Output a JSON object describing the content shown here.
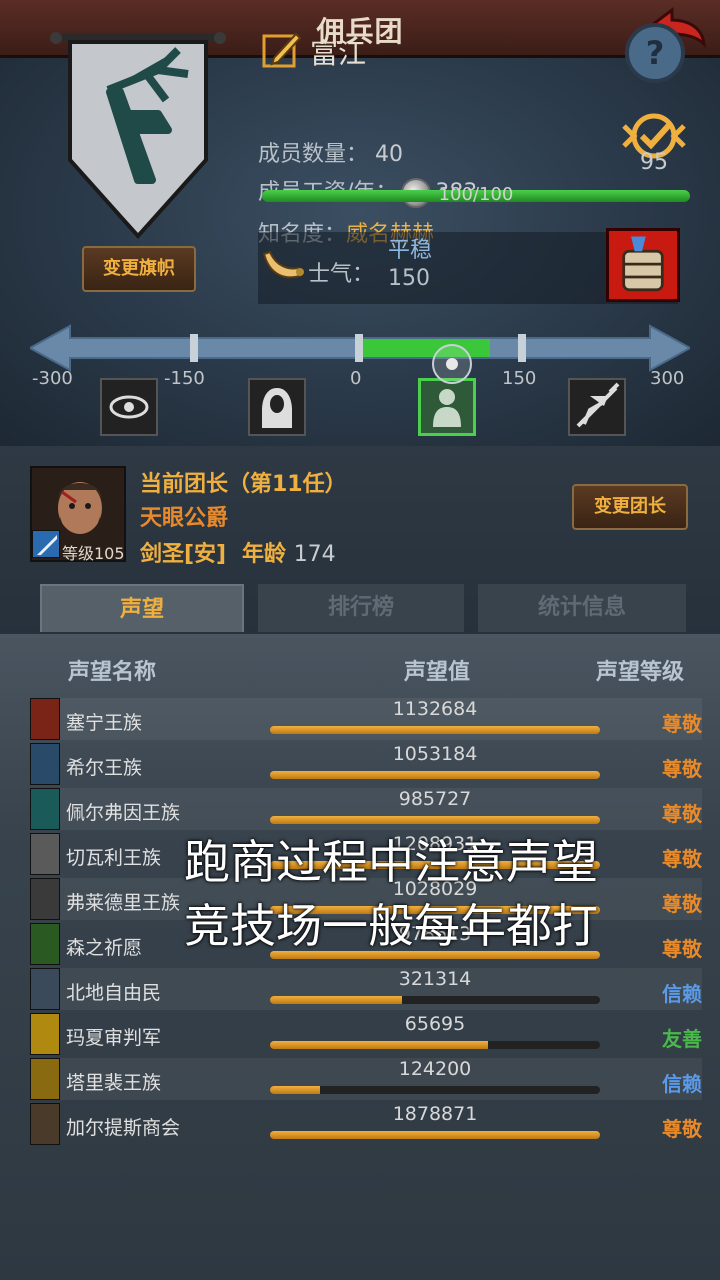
{
  "header": {
    "title": "佣兵团"
  },
  "guild": {
    "name": "富江",
    "members_label": "成员数量：",
    "members_value": "40",
    "salary_label": "成员工资/年：",
    "salary_value": "383",
    "fame_label": "知名度：",
    "fame_value": "威名赫赫",
    "fame_bar_text": "100/100",
    "fame_progress": 1.0,
    "rank_number": "95",
    "change_banner_label": "变更旗帜"
  },
  "morale": {
    "label": "士气：",
    "state": "平稳",
    "value": "150",
    "ticks": [
      "-300",
      "-150",
      "0",
      "150",
      "300"
    ]
  },
  "leader": {
    "role": "当前团长（第11任）",
    "title": "天眼公爵",
    "level_text": "等级105",
    "class": "剑圣[安]",
    "age_label": "年龄",
    "age_value": "174",
    "change_leader_label": "变更团长"
  },
  "tabs": [
    {
      "label": "声望",
      "active": true
    },
    {
      "label": "排行榜",
      "active": false
    },
    {
      "label": "统计信息",
      "active": false
    }
  ],
  "table": {
    "headers": {
      "name": "声望名称",
      "value": "声望值",
      "level": "声望等级"
    },
    "rows": [
      {
        "name": "塞宁王族",
        "value": "1132684",
        "level": "尊敬",
        "progress": 1.0,
        "icon_color": "#7a2418"
      },
      {
        "name": "希尔王族",
        "value": "1053184",
        "level": "尊敬",
        "progress": 1.0,
        "icon_color": "#2a4a6a"
      },
      {
        "name": "佩尔弗因王族",
        "value": "985727",
        "level": "尊敬",
        "progress": 1.0,
        "icon_color": "#1a5a58"
      },
      {
        "name": "切瓦利王族",
        "value": "1208931",
        "level": "尊敬",
        "progress": 1.0,
        "icon_color": "#5a5a5a"
      },
      {
        "name": "弗莱德里王族",
        "value": "1028029",
        "level": "尊敬",
        "progress": 1.0,
        "icon_color": "#3a3a3a"
      },
      {
        "name": "森之祈愿",
        "value": "978613",
        "level": "尊敬",
        "progress": 1.0,
        "icon_color": "#2a5a22"
      },
      {
        "name": "北地自由民",
        "value": "321314",
        "level": "信赖",
        "progress": 0.4,
        "icon_color": "#3a4a5a"
      },
      {
        "name": "玛夏审判军",
        "value": "65695",
        "level": "友善",
        "progress": 0.66,
        "icon_color": "#b08a10"
      },
      {
        "name": "塔里裴王族",
        "value": "124200",
        "level": "信赖",
        "progress": 0.15,
        "icon_color": "#8a6a10"
      },
      {
        "name": "加尔提斯商会",
        "value": "1878871",
        "level": "尊敬",
        "progress": 1.0,
        "icon_color": "#4a3a2a"
      }
    ]
  },
  "level_colors": {
    "尊敬": "#e8892a",
    "信赖": "#5a9ae8",
    "友善": "#4ab84a"
  },
  "overlay": {
    "line1": "跑商过程中注意声望",
    "line2": "竞技场一般每年都打"
  }
}
